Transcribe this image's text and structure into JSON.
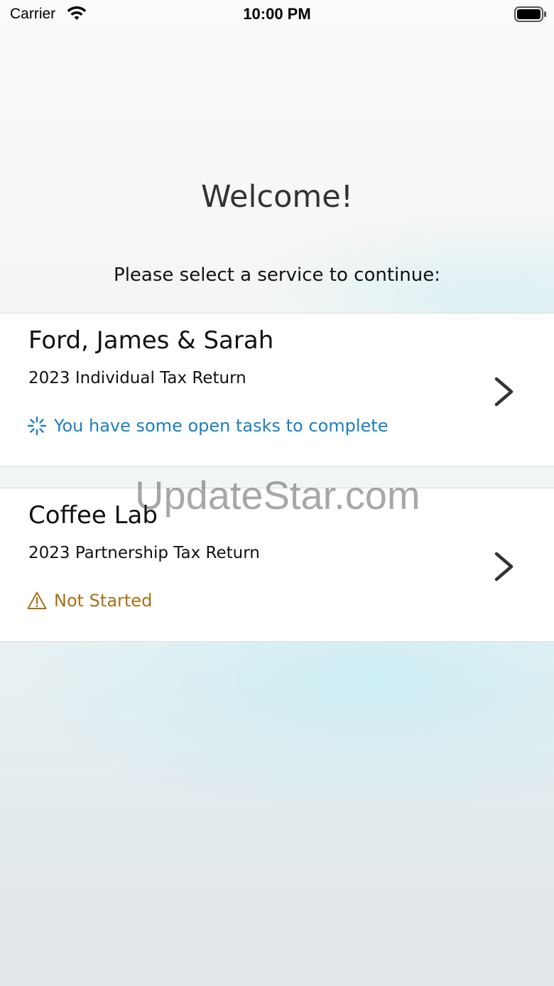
{
  "status_bar": {
    "carrier": "Carrier",
    "time": "10:00 PM"
  },
  "header": {
    "title": "Welcome!",
    "subtitle": "Please select a service to continue:"
  },
  "services": [
    {
      "name": "Ford, James & Sarah",
      "description": "2023 Individual Tax Return",
      "status": "You have some open tasks to complete",
      "status_icon": "spinner-icon",
      "status_color": "#1a7fbf"
    },
    {
      "name": "Coffee Lab",
      "description": "2023 Partnership Tax Return",
      "status": "Not Started",
      "status_icon": "warning-icon",
      "status_color": "#a87018"
    }
  ],
  "watermark": "UpdateStar.com"
}
